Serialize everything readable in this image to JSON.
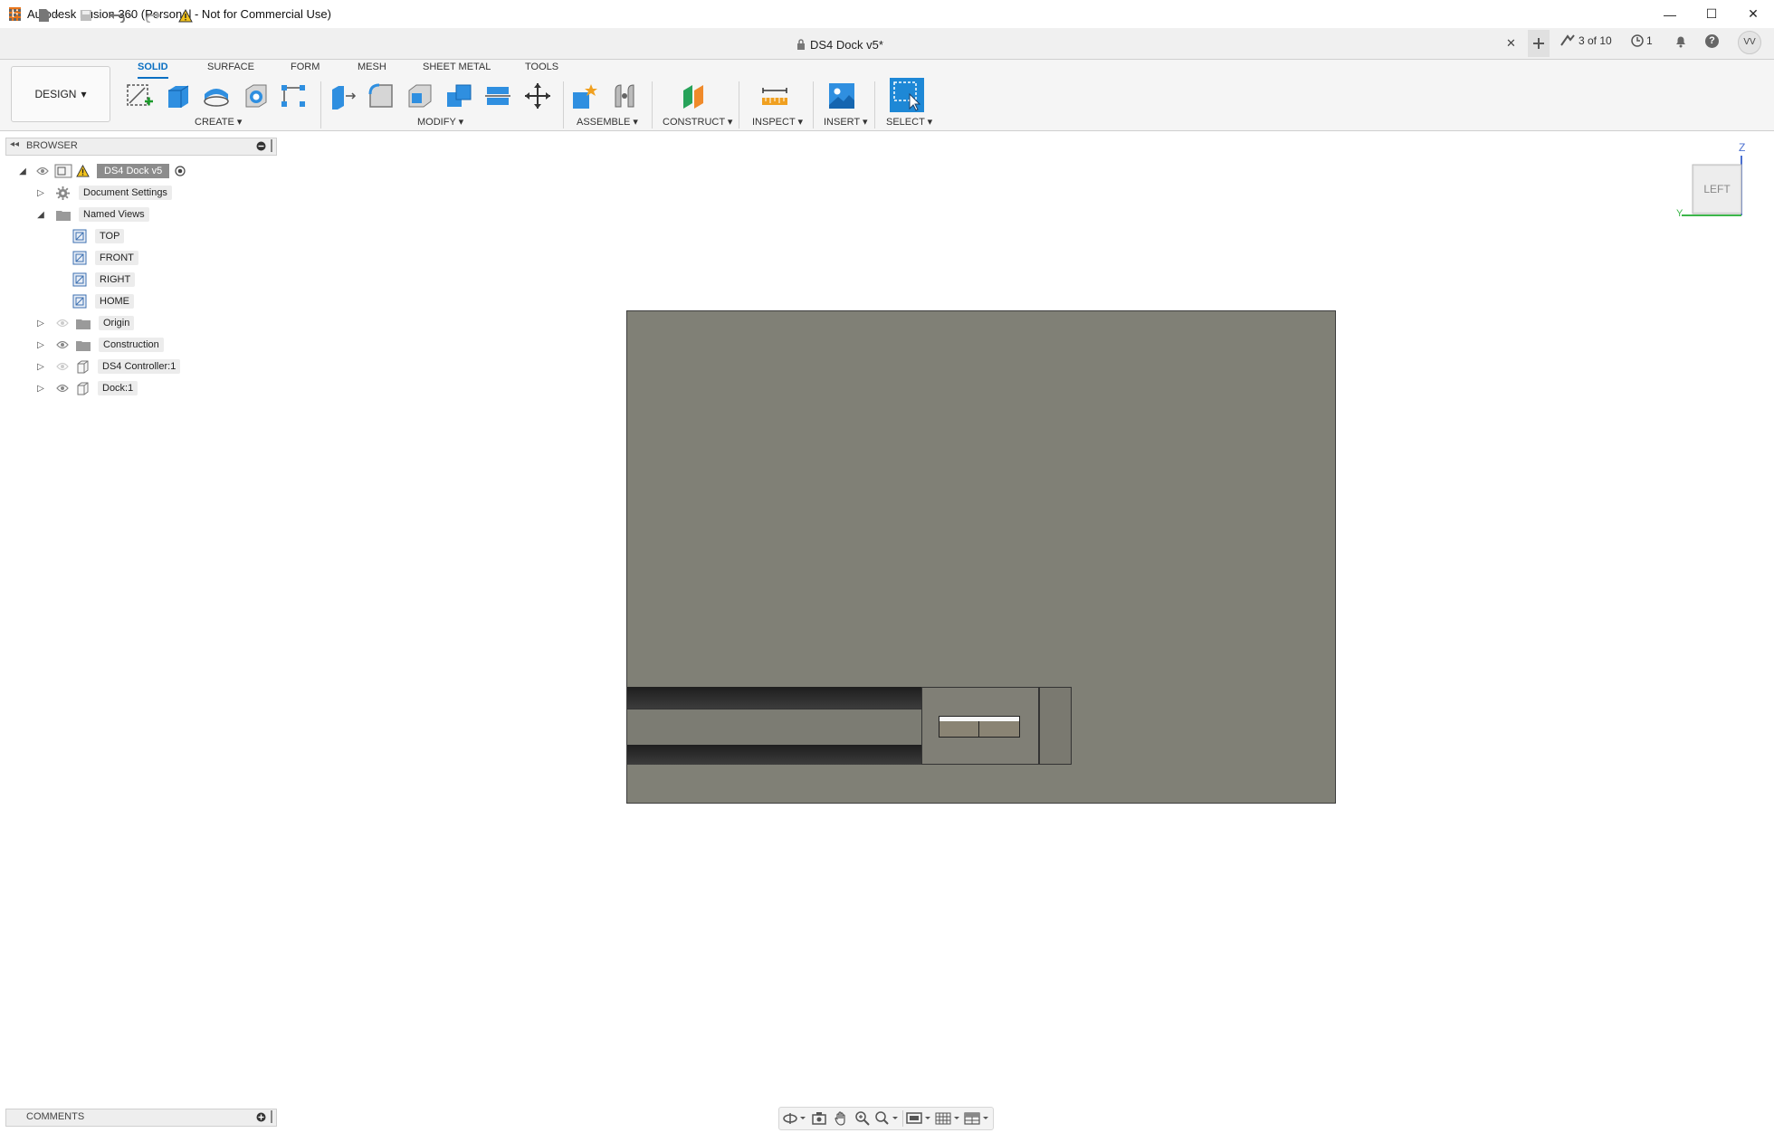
{
  "window": {
    "title": "Autodesk Fusion 360 (Personal - Not for Commercial Use)",
    "logo_letter": "F",
    "minimize": "—",
    "maximize": "☐",
    "close": "✕"
  },
  "document_tab": {
    "title": "DS4 Dock v5*",
    "close": "✕"
  },
  "quick_access": {
    "jobs": "3 of 10",
    "clock_count": "1",
    "user_initials": "VV"
  },
  "workspace": {
    "label": "DESIGN",
    "arrow": "▾"
  },
  "ribbon_tabs": [
    {
      "label": "SOLID",
      "active": true
    },
    {
      "label": "SURFACE",
      "active": false
    },
    {
      "label": "FORM",
      "active": false
    },
    {
      "label": "MESH",
      "active": false
    },
    {
      "label": "SHEET METAL",
      "active": false
    },
    {
      "label": "TOOLS",
      "active": false
    }
  ],
  "ribbon_groups": {
    "create": "CREATE ▾",
    "modify": "MODIFY ▾",
    "assemble": "ASSEMBLE ▾",
    "construct": "CONSTRUCT ▾",
    "inspect": "INSPECT ▾",
    "insert": "INSERT ▾",
    "select": "SELECT ▾"
  },
  "browser": {
    "title": "BROWSER",
    "root": "DS4 Dock v5",
    "items": [
      {
        "label": "Document Settings"
      },
      {
        "label": "Named Views"
      },
      {
        "label": "TOP"
      },
      {
        "label": "FRONT"
      },
      {
        "label": "RIGHT"
      },
      {
        "label": "HOME"
      },
      {
        "label": "Origin"
      },
      {
        "label": "Construction"
      },
      {
        "label": "DS4 Controller:1"
      },
      {
        "label": "Dock:1"
      }
    ]
  },
  "viewcube": {
    "face": "LEFT",
    "axis_z": "Z",
    "axis_y": "Y"
  },
  "comments": {
    "title": "COMMENTS"
  },
  "colors": {
    "accent": "#0a6fc2",
    "model_body": "#808076",
    "app_logo": "#e8751a"
  }
}
